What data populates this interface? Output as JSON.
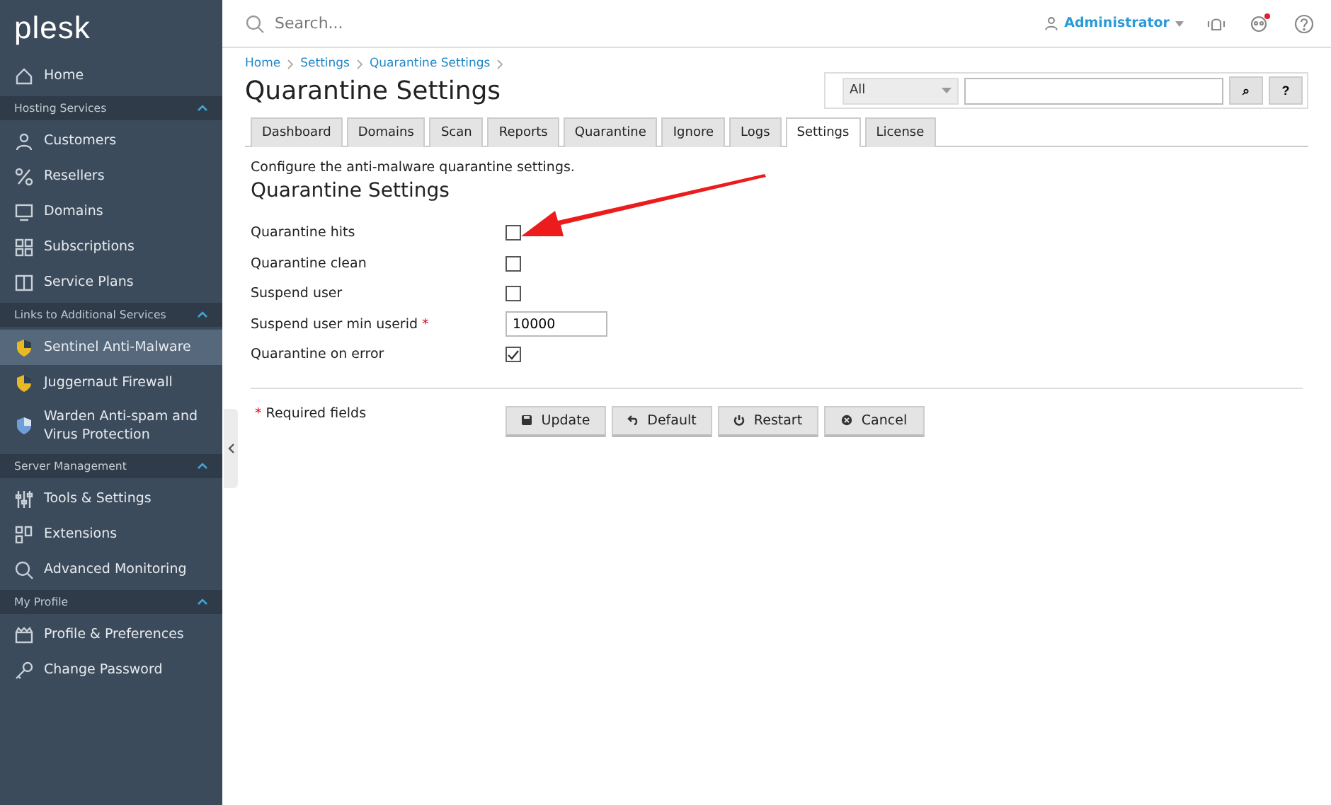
{
  "sidebar": {
    "logo": "plesk",
    "top_items": [
      {
        "label": "Home",
        "selected": false
      }
    ],
    "sections": [
      {
        "title": "Hosting Services",
        "expanded": true,
        "items": [
          {
            "label": "Customers",
            "selected": false
          },
          {
            "label": "Resellers",
            "selected": false
          },
          {
            "label": "Domains",
            "selected": false
          },
          {
            "label": "Subscriptions",
            "selected": false
          },
          {
            "label": "Service Plans",
            "selected": false
          }
        ]
      },
      {
        "title": "Links to Additional Services",
        "expanded": true,
        "items": [
          {
            "label": "Sentinel Anti-Malware",
            "selected": true
          },
          {
            "label": "Juggernaut Firewall",
            "selected": false
          },
          {
            "label": "Warden Anti-spam and Virus Protection",
            "selected": false
          }
        ]
      },
      {
        "title": "Server Management",
        "expanded": true,
        "items": [
          {
            "label": "Tools & Settings",
            "selected": false
          },
          {
            "label": "Extensions",
            "selected": false
          },
          {
            "label": "Advanced Monitoring",
            "selected": false
          }
        ]
      },
      {
        "title": "My Profile",
        "expanded": true,
        "items": [
          {
            "label": "Profile & Preferences",
            "selected": false
          },
          {
            "label": "Change Password",
            "selected": false
          }
        ]
      }
    ]
  },
  "topbar": {
    "search": {
      "placeholder": "Search..."
    },
    "user": "Administrator"
  },
  "breadcrumbs": [
    "Home",
    "Settings",
    "Quarantine Settings"
  ],
  "page_title": "Quarantine Settings",
  "filter": {
    "scope": "All",
    "search_button": "⌕",
    "help_button": "?"
  },
  "tabs": [
    {
      "label": "Dashboard",
      "selected": false
    },
    {
      "label": "Domains",
      "selected": false
    },
    {
      "label": "Scan",
      "selected": false
    },
    {
      "label": "Reports",
      "selected": false
    },
    {
      "label": "Quarantine",
      "selected": false
    },
    {
      "label": "Ignore",
      "selected": false
    },
    {
      "label": "Logs",
      "selected": false
    },
    {
      "label": "Settings",
      "selected": true
    },
    {
      "label": "License",
      "selected": false
    }
  ],
  "description": "Configure the anti-malware quarantine settings.",
  "form_title": "Quarantine Settings",
  "fields": [
    {
      "kind": "checkbox",
      "label": "Quarantine hits",
      "checked": false
    },
    {
      "kind": "checkbox",
      "label": "Quarantine clean",
      "checked": false
    },
    {
      "kind": "checkbox",
      "label": "Suspend user",
      "checked": false
    },
    {
      "kind": "text",
      "label": "Suspend user min userid",
      "required_mark": "*",
      "value": "10000"
    },
    {
      "kind": "checkbox",
      "label": "Quarantine on error",
      "checked": true
    }
  ],
  "required_note": {
    "mark": "*",
    "text": "Required fields"
  },
  "buttons": [
    "Update",
    "Default",
    "Restart",
    "Cancel"
  ]
}
